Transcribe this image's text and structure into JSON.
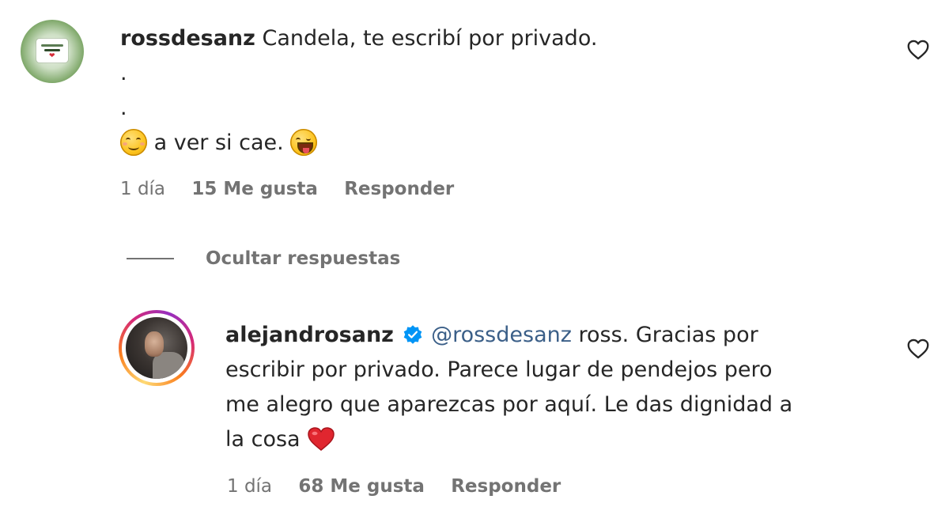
{
  "comments": [
    {
      "username": "rossdesanz",
      "text_line1": "Candela, te escribí por privado.",
      "text_line2": ".",
      "text_line3": ".",
      "text_line4": "a ver si cae.",
      "time": "1 día",
      "likes": "15 Me gusta",
      "reply": "Responder"
    }
  ],
  "toggle_replies": {
    "label": "Ocultar respuestas"
  },
  "reply": {
    "username": "alejandrosanz",
    "mention": "@rossdesanz",
    "text_line1_rest": "ross. Gracias por",
    "text_line2": "escribir por privado. Parece lugar de pendejos pero",
    "text_line3": "me alegro que aparezcas por aquí. Le das dignidad a",
    "text_line4": "la cosa",
    "time": "1 día",
    "likes": "68 Me gusta",
    "reply": "Responder"
  },
  "colors": {
    "text": "#262626",
    "secondary": "#737373",
    "mention": "#3b5f88",
    "verified": "#0095f6",
    "heart_red": "#e0262f"
  },
  "icons": [
    "like-heart-icon",
    "verified-badge-icon",
    "smiling-face-emoji",
    "winking-tongue-emoji",
    "red-heart-emoji"
  ]
}
